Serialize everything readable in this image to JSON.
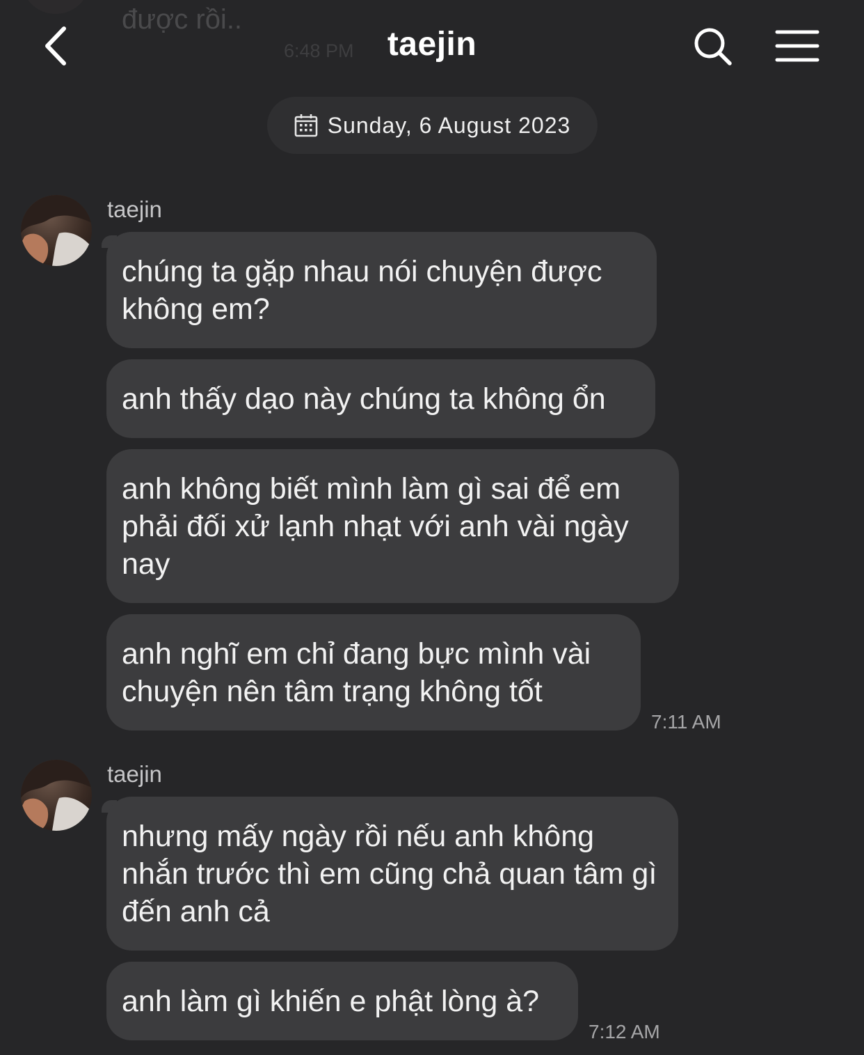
{
  "header": {
    "title": "taejin",
    "back_icon": "chevron-left-icon",
    "search_icon": "search-icon",
    "menu_icon": "hamburger-menu-icon"
  },
  "scrolled_preview": {
    "text": "được rồi..",
    "time": "6:48 PM"
  },
  "date_separator": {
    "icon": "calendar-icon",
    "label": "Sunday, 6 August 2023"
  },
  "groups": [
    {
      "sender": "taejin",
      "time": "7:11 AM",
      "messages": [
        "chúng ta gặp nhau nói chuyện được không em?",
        "anh thấy dạo này chúng ta không ổn",
        "anh không biết mình làm gì sai để em phải đối xử lạnh nhạt với anh vài ngày nay",
        "anh nghĩ em chỉ đang bực mình vài chuyện nên tâm trạng không tốt"
      ]
    },
    {
      "sender": "taejin",
      "time": "7:12 AM",
      "messages": [
        "nhưng mấy ngày rồi nếu anh không nhắn trước thì em cũng chả quan tâm gì đến anh cả",
        "anh làm gì khiến e phật lòng à?"
      ]
    }
  ],
  "colors": {
    "background": "#262628",
    "bubble": "#3c3c3e",
    "date_pill": "#2f2f31",
    "text": "#f2f2f2",
    "secondary_text": "#a6a6a8"
  }
}
